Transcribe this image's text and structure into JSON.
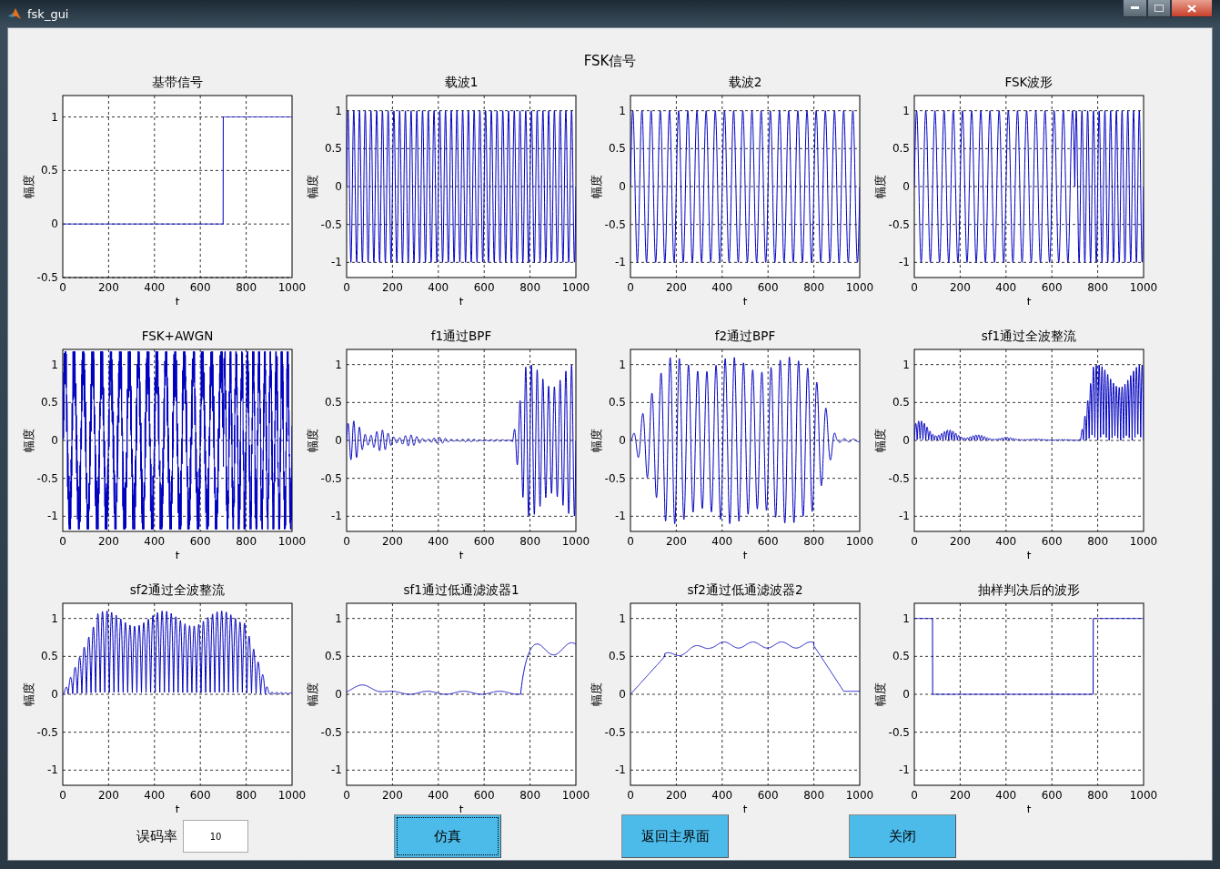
{
  "window": {
    "title": "fsk_gui"
  },
  "figure_title": "FSK信号",
  "plots": [
    {
      "title": "基带信号",
      "kind": "step_up",
      "ylabel": "幅度",
      "xlabel": "t",
      "xticks": [
        "0",
        "200",
        "400",
        "600",
        "800",
        "1000"
      ],
      "yticks": [
        "1",
        "0.5",
        "0",
        "-0.5"
      ]
    },
    {
      "title": "载波1",
      "kind": "carrier_high",
      "ylabel": "幅度",
      "xlabel": "t",
      "xticks": [
        "0",
        "200",
        "400",
        "600",
        "800",
        "1000"
      ],
      "yticks": [
        "1",
        "0.5",
        "0",
        "-0.5",
        "-1"
      ]
    },
    {
      "title": "载波2",
      "kind": "carrier_low",
      "ylabel": "幅度",
      "xlabel": "t",
      "xticks": [
        "0",
        "200",
        "400",
        "600",
        "800",
        "1000"
      ],
      "yticks": [
        "1",
        "0.5",
        "0",
        "-0.5",
        "-1"
      ]
    },
    {
      "title": "FSK波形",
      "kind": "fsk",
      "ylabel": "幅度",
      "xlabel": "t",
      "xticks": [
        "0",
        "200",
        "400",
        "600",
        "800",
        "1000"
      ],
      "yticks": [
        "1",
        "0.5",
        "0",
        "-0.5",
        "-1"
      ]
    },
    {
      "title": "FSK+AWGN",
      "kind": "noisy",
      "ylabel": "幅度",
      "xlabel": "t",
      "xticks": [
        "0",
        "200",
        "400",
        "600",
        "800",
        "1000"
      ],
      "yticks": [
        "1",
        "0.5",
        "0",
        "-0.5",
        "-1"
      ]
    },
    {
      "title": "f1通过BPF",
      "kind": "bpf1",
      "ylabel": "幅度",
      "xlabel": "t",
      "xticks": [
        "0",
        "200",
        "400",
        "600",
        "800",
        "1000"
      ],
      "yticks": [
        "1",
        "0.5",
        "0",
        "-0.5",
        "-1"
      ]
    },
    {
      "title": "f2通过BPF",
      "kind": "bpf2",
      "ylabel": "幅度",
      "xlabel": "t",
      "xticks": [
        "0",
        "200",
        "400",
        "600",
        "800",
        "1000"
      ],
      "yticks": [
        "1",
        "0.5",
        "0",
        "-0.5",
        "-1"
      ]
    },
    {
      "title": "sf1通过全波整流",
      "kind": "rect1",
      "ylabel": "幅度",
      "xlabel": "t",
      "xticks": [
        "0",
        "200",
        "400",
        "600",
        "800",
        "1000"
      ],
      "yticks": [
        "1",
        "0.5",
        "0",
        "-0.5",
        "-1"
      ]
    },
    {
      "title": "sf2通过全波整流",
      "kind": "rect2",
      "ylabel": "幅度",
      "xlabel": "t",
      "xticks": [
        "0",
        "200",
        "400",
        "600",
        "800",
        "1000"
      ],
      "yticks": [
        "1",
        "0.5",
        "0",
        "-0.5",
        "-1"
      ]
    },
    {
      "title": "sf1通过低通滤波器1",
      "kind": "lpf1",
      "ylabel": "幅度",
      "xlabel": "t",
      "xticks": [
        "0",
        "200",
        "400",
        "600",
        "800",
        "1000"
      ],
      "yticks": [
        "1",
        "0.5",
        "0",
        "-0.5",
        "-1"
      ]
    },
    {
      "title": "sf2通过低通滤波器2",
      "kind": "lpf2",
      "ylabel": "幅度",
      "xlabel": "t",
      "xticks": [
        "0",
        "200",
        "400",
        "600",
        "800",
        "1000"
      ],
      "yticks": [
        "1",
        "0.5",
        "0",
        "-0.5",
        "-1"
      ]
    },
    {
      "title": "抽样判决后的波形",
      "kind": "decision",
      "ylabel": "幅度",
      "xlabel": "t",
      "xticks": [
        "0",
        "200",
        "400",
        "600",
        "800",
        "1000"
      ],
      "yticks": [
        "1",
        "0.5",
        "0",
        "-0.5",
        "-1"
      ]
    }
  ],
  "ber": {
    "label": "误码率",
    "value": "10"
  },
  "buttons": [
    {
      "label": "仿真",
      "focused": true
    },
    {
      "label": "返回主界面",
      "focused": false
    },
    {
      "label": "关闭",
      "focused": false
    }
  ]
}
